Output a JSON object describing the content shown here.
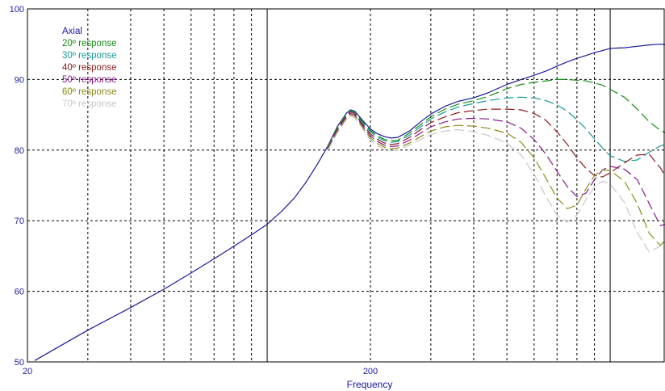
{
  "chart_data": {
    "type": "line",
    "title": "",
    "xlabel": "Frequency",
    "ylabel": "",
    "x_scale": "log",
    "xlim": [
      20,
      1000
    ],
    "ylim": [
      50,
      100
    ],
    "x_ticks": [
      {
        "value": 20,
        "label": "20"
      },
      {
        "value": 200,
        "label": "200"
      }
    ],
    "y_ticks": [
      50,
      60,
      70,
      80,
      90,
      100
    ],
    "grid": true,
    "legend_position": "top-left",
    "series": [
      {
        "name": "Axial",
        "color": "#1a1a9c",
        "dash": "solid",
        "points": [
          [
            21,
            50.2
          ],
          [
            30,
            54.5
          ],
          [
            40,
            57.7
          ],
          [
            50,
            60.3
          ],
          [
            60,
            62.6
          ],
          [
            70,
            64.6
          ],
          [
            80,
            66.4
          ],
          [
            90,
            68.0
          ],
          [
            100,
            69.5
          ],
          [
            110,
            71.3
          ],
          [
            120,
            73.2
          ],
          [
            130,
            75.5
          ],
          [
            140,
            78.0
          ],
          [
            150,
            80.5
          ],
          [
            160,
            83.3
          ],
          [
            170,
            85.2
          ],
          [
            175,
            85.7
          ],
          [
            180,
            85.5
          ],
          [
            190,
            84.2
          ],
          [
            200,
            83.0
          ],
          [
            210,
            82.3
          ],
          [
            220,
            81.9
          ],
          [
            230,
            81.7
          ],
          [
            240,
            81.8
          ],
          [
            260,
            82.7
          ],
          [
            280,
            84.0
          ],
          [
            300,
            85.1
          ],
          [
            330,
            86.2
          ],
          [
            360,
            86.9
          ],
          [
            400,
            87.4
          ],
          [
            440,
            88.1
          ],
          [
            500,
            89.3
          ],
          [
            550,
            90.0
          ],
          [
            600,
            90.6
          ],
          [
            650,
            91.2
          ],
          [
            700,
            91.9
          ],
          [
            750,
            92.5
          ],
          [
            800,
            93.0
          ],
          [
            850,
            93.4
          ],
          [
            900,
            93.8
          ],
          [
            950,
            94.1
          ],
          [
            1000,
            94.4
          ],
          [
            1100,
            94.5
          ],
          [
            1200,
            94.7
          ],
          [
            1300,
            94.9
          ],
          [
            1400,
            95.0
          ],
          [
            1500,
            94.9
          ]
        ]
      },
      {
        "name": "20º response",
        "color": "#138c13",
        "dash": "12 5",
        "points": [
          [
            150,
            80.4
          ],
          [
            160,
            83.2
          ],
          [
            170,
            85.1
          ],
          [
            175,
            85.6
          ],
          [
            180,
            85.4
          ],
          [
            190,
            84.0
          ],
          [
            200,
            82.8
          ],
          [
            210,
            82.0
          ],
          [
            220,
            81.5
          ],
          [
            230,
            81.3
          ],
          [
            240,
            81.4
          ],
          [
            260,
            82.4
          ],
          [
            280,
            83.6
          ],
          [
            300,
            84.7
          ],
          [
            330,
            85.8
          ],
          [
            360,
            86.5
          ],
          [
            400,
            87.0
          ],
          [
            440,
            87.6
          ],
          [
            500,
            88.7
          ],
          [
            550,
            89.3
          ],
          [
            600,
            89.6
          ],
          [
            650,
            89.8
          ],
          [
            700,
            90.0
          ],
          [
            750,
            90.0
          ],
          [
            800,
            89.9
          ],
          [
            850,
            89.8
          ],
          [
            900,
            89.5
          ],
          [
            950,
            89.2
          ],
          [
            1000,
            88.6
          ],
          [
            1100,
            87.5
          ],
          [
            1200,
            85.8
          ],
          [
            1300,
            84.0
          ],
          [
            1400,
            82.8
          ],
          [
            1500,
            82.1
          ]
        ]
      },
      {
        "name": "30º response",
        "color": "#169a9a",
        "dash": "12 5",
        "points": [
          [
            150,
            80.3
          ],
          [
            160,
            83.0
          ],
          [
            170,
            85.0
          ],
          [
            175,
            85.5
          ],
          [
            180,
            85.3
          ],
          [
            190,
            83.8
          ],
          [
            200,
            82.6
          ],
          [
            210,
            81.8
          ],
          [
            220,
            81.3
          ],
          [
            230,
            81.1
          ],
          [
            240,
            81.2
          ],
          [
            260,
            82.1
          ],
          [
            280,
            83.3
          ],
          [
            300,
            84.4
          ],
          [
            330,
            85.4
          ],
          [
            360,
            86.1
          ],
          [
            400,
            86.6
          ],
          [
            440,
            87.0
          ],
          [
            500,
            87.4
          ],
          [
            550,
            87.5
          ],
          [
            600,
            87.4
          ],
          [
            650,
            87.0
          ],
          [
            700,
            86.4
          ],
          [
            750,
            85.5
          ],
          [
            800,
            84.3
          ],
          [
            850,
            83.0
          ],
          [
            900,
            81.6
          ],
          [
            950,
            80.3
          ],
          [
            1000,
            79.2
          ],
          [
            1100,
            78.4
          ],
          [
            1200,
            78.6
          ],
          [
            1300,
            79.7
          ],
          [
            1400,
            80.6
          ],
          [
            1500,
            80.9
          ]
        ]
      },
      {
        "name": "40º response",
        "color": "#8e1a1a",
        "dash": "12 5",
        "points": [
          [
            150,
            80.2
          ],
          [
            160,
            82.9
          ],
          [
            170,
            84.9
          ],
          [
            175,
            85.4
          ],
          [
            180,
            85.2
          ],
          [
            190,
            83.6
          ],
          [
            200,
            82.3
          ],
          [
            210,
            81.5
          ],
          [
            220,
            81.0
          ],
          [
            230,
            80.8
          ],
          [
            240,
            80.9
          ],
          [
            260,
            81.8
          ],
          [
            280,
            82.9
          ],
          [
            300,
            83.9
          ],
          [
            330,
            84.7
          ],
          [
            360,
            85.3
          ],
          [
            400,
            85.6
          ],
          [
            440,
            85.8
          ],
          [
            500,
            85.8
          ],
          [
            550,
            85.7
          ],
          [
            600,
            85.2
          ],
          [
            650,
            84.2
          ],
          [
            700,
            82.6
          ],
          [
            750,
            80.8
          ],
          [
            800,
            78.9
          ],
          [
            850,
            77.4
          ],
          [
            900,
            76.4
          ],
          [
            950,
            76.2
          ],
          [
            1000,
            76.8
          ],
          [
            1100,
            78.2
          ],
          [
            1200,
            79.3
          ],
          [
            1300,
            79.4
          ],
          [
            1400,
            77.5
          ],
          [
            1500,
            75.1
          ]
        ]
      },
      {
        "name": "50º response",
        "color": "#8c1a8c",
        "dash": "12 5",
        "points": [
          [
            150,
            80.1
          ],
          [
            160,
            82.8
          ],
          [
            170,
            84.7
          ],
          [
            175,
            85.2
          ],
          [
            180,
            85.0
          ],
          [
            190,
            83.4
          ],
          [
            200,
            82.0
          ],
          [
            210,
            81.2
          ],
          [
            220,
            80.7
          ],
          [
            230,
            80.5
          ],
          [
            240,
            80.6
          ],
          [
            260,
            81.4
          ],
          [
            280,
            82.4
          ],
          [
            300,
            83.3
          ],
          [
            330,
            84.0
          ],
          [
            360,
            84.4
          ],
          [
            400,
            84.5
          ],
          [
            440,
            84.4
          ],
          [
            500,
            84.0
          ],
          [
            550,
            83.1
          ],
          [
            600,
            81.5
          ],
          [
            650,
            79.4
          ],
          [
            700,
            77.0
          ],
          [
            750,
            74.8
          ],
          [
            800,
            73.4
          ],
          [
            850,
            73.9
          ],
          [
            900,
            75.8
          ],
          [
            950,
            77.2
          ],
          [
            1000,
            77.7
          ],
          [
            1100,
            77.3
          ],
          [
            1200,
            75.8
          ],
          [
            1300,
            72.4
          ],
          [
            1400,
            69.3
          ],
          [
            1500,
            69.7
          ]
        ]
      },
      {
        "name": "60º response",
        "color": "#8c8c14",
        "dash": "12 5",
        "points": [
          [
            150,
            80.0
          ],
          [
            160,
            82.6
          ],
          [
            170,
            84.5
          ],
          [
            175,
            85.0
          ],
          [
            180,
            84.8
          ],
          [
            190,
            83.2
          ],
          [
            200,
            81.7
          ],
          [
            210,
            80.9
          ],
          [
            220,
            80.4
          ],
          [
            230,
            80.2
          ],
          [
            240,
            80.3
          ],
          [
            260,
            81.0
          ],
          [
            280,
            81.9
          ],
          [
            300,
            82.7
          ],
          [
            330,
            83.3
          ],
          [
            360,
            83.5
          ],
          [
            400,
            83.4
          ],
          [
            440,
            83.1
          ],
          [
            500,
            82.4
          ],
          [
            550,
            81.1
          ],
          [
            600,
            78.9
          ],
          [
            650,
            76.0
          ],
          [
            700,
            73.2
          ],
          [
            750,
            71.7
          ],
          [
            800,
            72.2
          ],
          [
            850,
            74.5
          ],
          [
            900,
            76.4
          ],
          [
            950,
            77.2
          ],
          [
            1000,
            77.1
          ],
          [
            1100,
            75.6
          ],
          [
            1200,
            72.4
          ],
          [
            1300,
            68.2
          ],
          [
            1400,
            66.5
          ],
          [
            1500,
            68.0
          ]
        ]
      },
      {
        "name": "70º response",
        "color": "#c8c8c8",
        "dash": "12 5",
        "points": [
          [
            150,
            79.9
          ],
          [
            160,
            82.4
          ],
          [
            170,
            84.3
          ],
          [
            175,
            84.8
          ],
          [
            180,
            84.6
          ],
          [
            190,
            83.0
          ],
          [
            200,
            81.4
          ],
          [
            210,
            80.6
          ],
          [
            220,
            80.1
          ],
          [
            230,
            79.9
          ],
          [
            240,
            80.0
          ],
          [
            260,
            80.7
          ],
          [
            280,
            81.5
          ],
          [
            300,
            82.2
          ],
          [
            330,
            82.7
          ],
          [
            360,
            82.9
          ],
          [
            400,
            82.6
          ],
          [
            440,
            82.1
          ],
          [
            500,
            81.0
          ],
          [
            550,
            79.3
          ],
          [
            600,
            76.6
          ],
          [
            650,
            73.4
          ],
          [
            700,
            70.8
          ],
          [
            750,
            69.8
          ],
          [
            800,
            70.8
          ],
          [
            850,
            73.0
          ],
          [
            900,
            74.8
          ],
          [
            950,
            75.6
          ],
          [
            1000,
            75.2
          ],
          [
            1100,
            72.6
          ],
          [
            1200,
            68.3
          ],
          [
            1300,
            65.6
          ],
          [
            1400,
            66.4
          ],
          [
            1500,
            67.9
          ]
        ]
      }
    ]
  }
}
